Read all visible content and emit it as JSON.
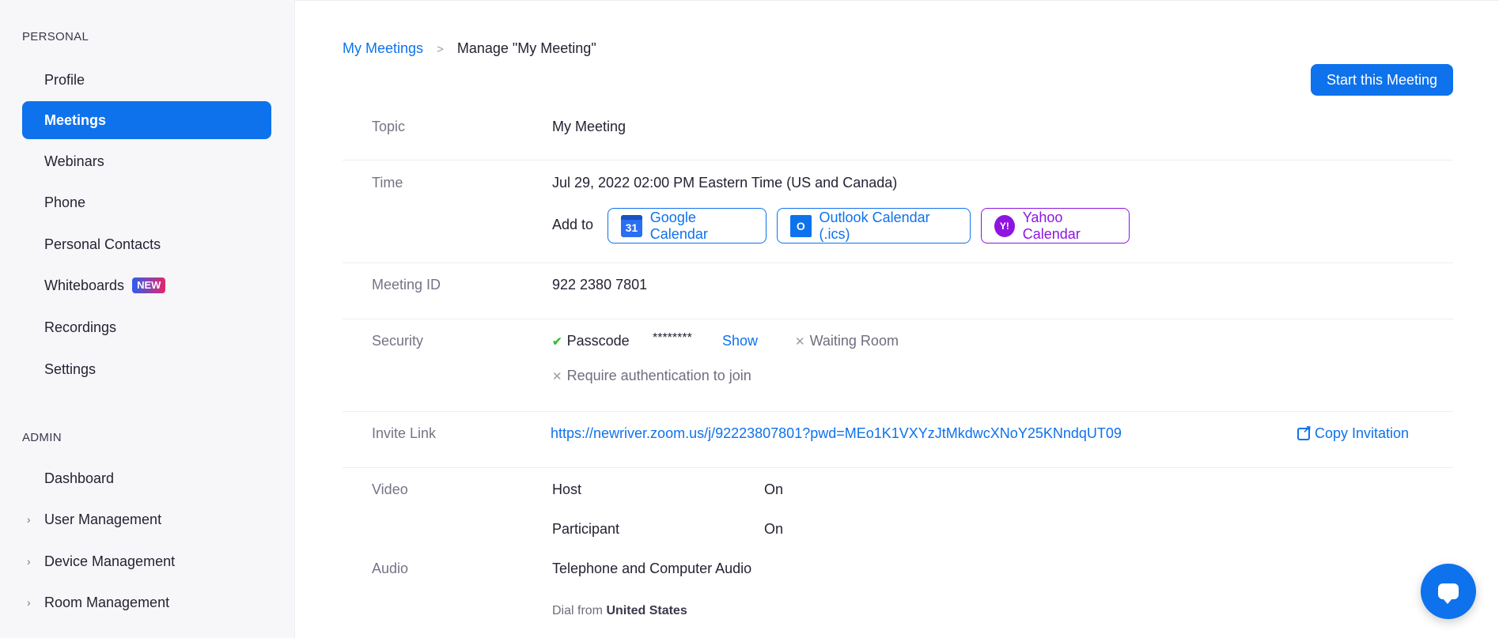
{
  "sidebar": {
    "personal_title": "PERSONAL",
    "personal_items": [
      {
        "label": "Profile"
      },
      {
        "label": "Meetings"
      },
      {
        "label": "Webinars"
      },
      {
        "label": "Phone"
      },
      {
        "label": "Personal Contacts"
      },
      {
        "label": "Whiteboards",
        "badge": "NEW"
      },
      {
        "label": "Recordings"
      },
      {
        "label": "Settings"
      }
    ],
    "admin_title": "ADMIN",
    "admin_items": [
      {
        "label": "Dashboard"
      },
      {
        "label": "User Management"
      },
      {
        "label": "Device Management"
      },
      {
        "label": "Room Management"
      }
    ]
  },
  "breadcrumb": {
    "parent": "My Meetings",
    "separator": ">",
    "current": "Manage \"My Meeting\""
  },
  "start_button": "Start this Meeting",
  "topic": {
    "label": "Topic",
    "value": "My Meeting"
  },
  "time": {
    "label": "Time",
    "value": "Jul 29, 2022 02:00 PM Eastern Time (US and Canada)",
    "add_to": "Add to",
    "google": "Google Calendar",
    "google_icon_text": "31",
    "outlook": "Outlook Calendar (.ics)",
    "outlook_icon_text": "O",
    "yahoo": "Yahoo Calendar",
    "yahoo_icon_text": "Y!"
  },
  "meeting_id": {
    "label": "Meeting ID",
    "value": "922 2380 7801"
  },
  "security": {
    "label": "Security",
    "passcode_label": "Passcode",
    "passcode_value": "********",
    "show": "Show",
    "waiting_room": "Waiting Room",
    "require_auth": "Require authentication to join"
  },
  "invite": {
    "label": "Invite Link",
    "url": "https://newriver.zoom.us/j/92223807801?pwd=MEo1K1VXYzJtMkdwcXNoY25KNndqUT09",
    "copy": "Copy Invitation"
  },
  "video": {
    "label": "Video",
    "host_label": "Host",
    "host_value": "On",
    "participant_label": "Participant",
    "participant_value": "On"
  },
  "audio": {
    "label": "Audio",
    "value": "Telephone and Computer Audio",
    "dial_from": "Dial from",
    "dial_country": "United States"
  },
  "colors": {
    "accent": "#0e72ed",
    "yahoo": "#8f14e0",
    "check": "#3fbd3f",
    "sidebar_bg": "#f7f7fa"
  },
  "icons": {
    "check": "check-icon",
    "x": "close-icon",
    "copy": "share-icon",
    "chat": "chat-icon",
    "chevron": "chevron-right-icon"
  }
}
